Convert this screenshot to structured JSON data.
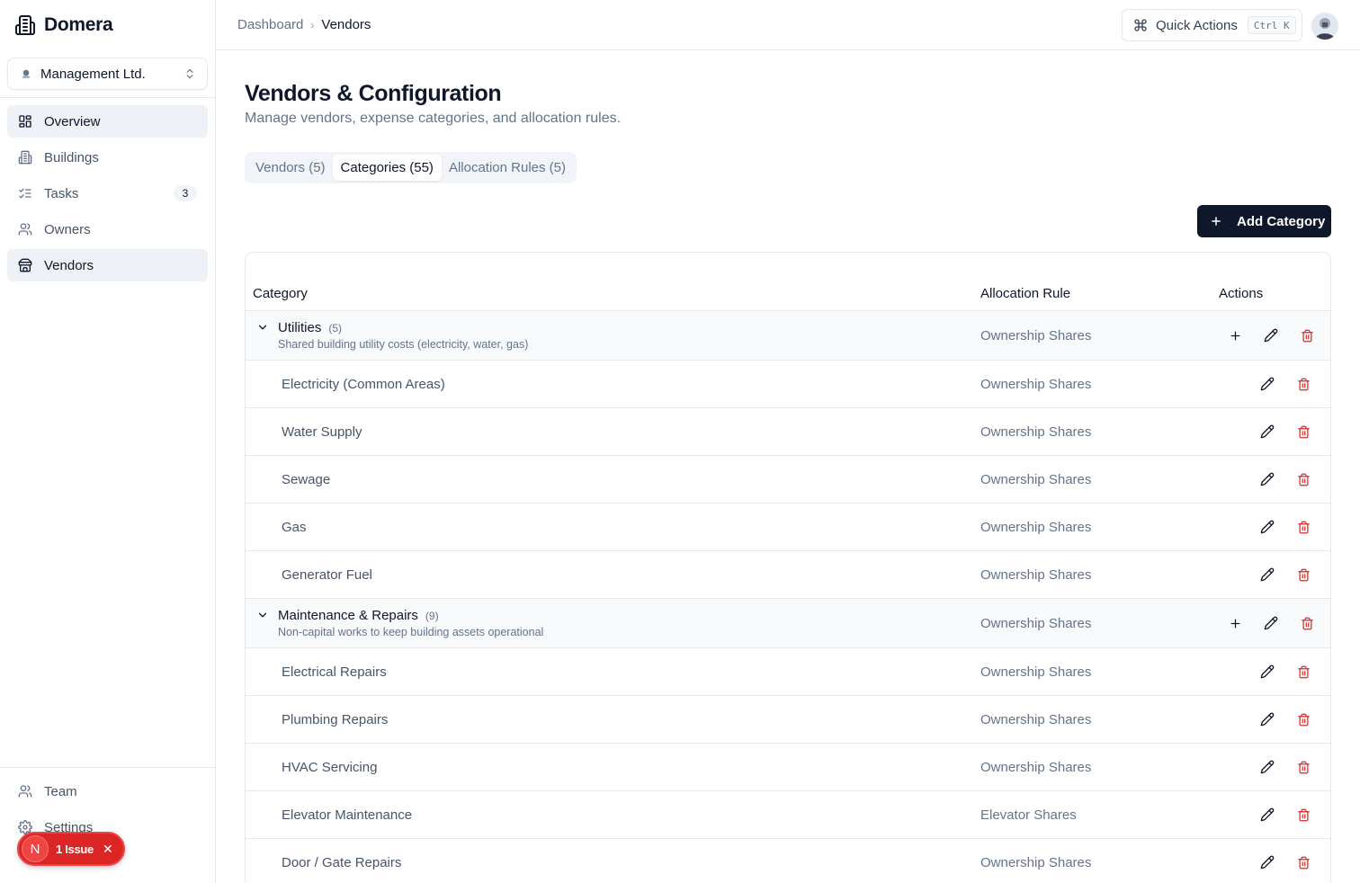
{
  "app": {
    "name": "Domera"
  },
  "org": {
    "name": "Management Ltd."
  },
  "nav": {
    "items": [
      {
        "label": "Overview",
        "icon": "dashboard-grid-icon"
      },
      {
        "label": "Buildings",
        "icon": "building-icon"
      },
      {
        "label": "Tasks",
        "icon": "list-checks-icon",
        "badge": "3"
      },
      {
        "label": "Owners",
        "icon": "users-icon"
      },
      {
        "label": "Vendors",
        "icon": "store-icon"
      }
    ],
    "bottom": [
      {
        "label": "Team",
        "icon": "users-icon"
      },
      {
        "label": "Settings",
        "icon": "gear-icon"
      }
    ]
  },
  "issue": {
    "avatar": "N",
    "label": "1 Issue"
  },
  "breadcrumb": {
    "root": "Dashboard",
    "separator": "›",
    "current": "Vendors"
  },
  "quick_actions": {
    "label": "Quick Actions",
    "shortcut": "Ctrl K"
  },
  "page": {
    "title": "Vendors & Configuration",
    "subtitle": "Manage vendors, expense categories, and allocation rules."
  },
  "tabs": [
    {
      "label": "Vendors (5)",
      "active": false
    },
    {
      "label": "Categories (55)",
      "active": true
    },
    {
      "label": "Allocation Rules (5)",
      "active": false
    }
  ],
  "add_button": {
    "label": "Add Category"
  },
  "table": {
    "headers": {
      "category": "Category",
      "rule": "Allocation Rule",
      "actions": "Actions"
    },
    "groups": [
      {
        "name": "Utilities",
        "count": "(5)",
        "description": "Shared building utility costs (electricity, water, gas)",
        "rule": "Ownership Shares",
        "children": [
          {
            "name": "Electricity (Common Areas)",
            "rule": "Ownership Shares"
          },
          {
            "name": "Water Supply",
            "rule": "Ownership Shares"
          },
          {
            "name": "Sewage",
            "rule": "Ownership Shares"
          },
          {
            "name": "Gas",
            "rule": "Ownership Shares"
          },
          {
            "name": "Generator Fuel",
            "rule": "Ownership Shares"
          }
        ]
      },
      {
        "name": "Maintenance & Repairs",
        "count": "(9)",
        "description": "Non-capital works to keep building assets operational",
        "rule": "Ownership Shares",
        "children": [
          {
            "name": "Electrical Repairs",
            "rule": "Ownership Shares"
          },
          {
            "name": "Plumbing Repairs",
            "rule": "Ownership Shares"
          },
          {
            "name": "HVAC Servicing",
            "rule": "Ownership Shares"
          },
          {
            "name": "Elevator Maintenance",
            "rule": "Elevator Shares"
          },
          {
            "name": "Door / Gate Repairs",
            "rule": "Ownership Shares"
          }
        ]
      }
    ]
  },
  "colors": {
    "primary": "#0f172a",
    "danger": "#dc2626",
    "muted": "#64748b",
    "border": "#e5e7eb"
  }
}
